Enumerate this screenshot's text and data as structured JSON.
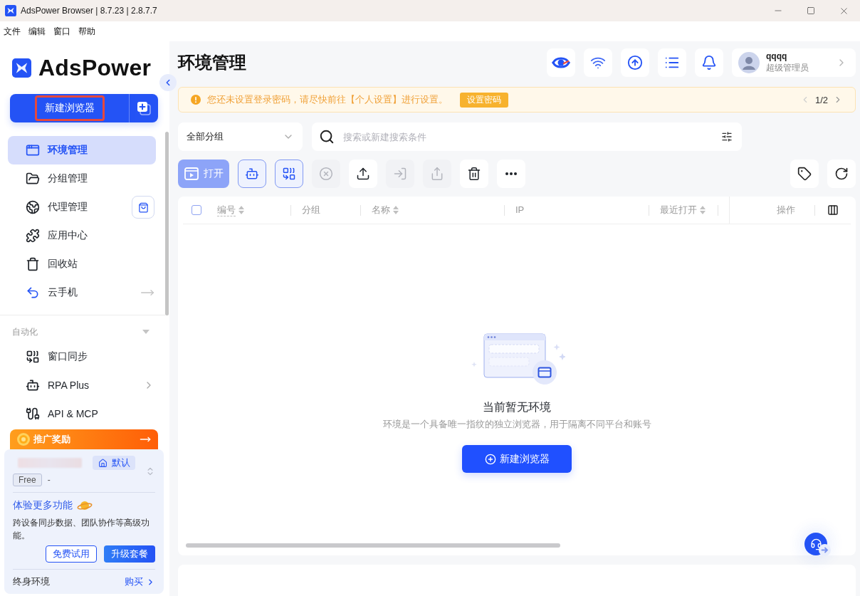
{
  "window": {
    "title": "AdsPower Browser | 8.7.23 | 2.8.7.7"
  },
  "menu_bar": [
    "文件",
    "编辑",
    "窗口",
    "帮助"
  ],
  "sidebar": {
    "logo": "AdsPower",
    "new_browser_button": {
      "label": "新建浏览器",
      "highlighted": true
    },
    "nav_items": [
      {
        "label": "环境管理",
        "selected": true,
        "kind": "plain"
      },
      {
        "label": "分组管理",
        "selected": false,
        "kind": "plain"
      },
      {
        "label": "代理管理",
        "selected": false,
        "kind": "shop"
      },
      {
        "label": "应用中心",
        "selected": false,
        "kind": "plain"
      },
      {
        "label": "回收站",
        "selected": false,
        "kind": "plain"
      },
      {
        "label": "云手机",
        "selected": false,
        "kind": "link"
      }
    ],
    "sections": [
      {
        "title": "自动化",
        "expanded": true,
        "items": [
          {
            "label": "窗口同步",
            "selected": false,
            "kind": "plain"
          },
          {
            "label": "RPA Plus",
            "selected": false,
            "kind": "submenu"
          },
          {
            "label": "API & MCP",
            "selected": false,
            "kind": "plain"
          }
        ]
      }
    ],
    "promo": {
      "banner": "推广奖励",
      "team_tag": "默认",
      "plan": "Free",
      "plan_expiry": "-",
      "upgrade_title": "体验更多功能",
      "upgrade_text": "跨设备同步数据、团队协作等高级功能。",
      "buttons": [
        {
          "label": "免费试用",
          "kind": "outline"
        },
        {
          "label": "升级套餐",
          "kind": "primary"
        }
      ],
      "lifetime_label": "终身环境",
      "lifetime_link": "购买"
    }
  },
  "header": {
    "title": "环境管理",
    "user": {
      "name": "qqqq",
      "role": "超级管理员"
    }
  },
  "notice": {
    "text": "您还未设置登录密码，请尽快前往【个人设置】进行设置。",
    "action": "设置密码",
    "page": "1/2"
  },
  "filters": {
    "group": {
      "value": "全部分组"
    },
    "search": {
      "placeholder": "搜索或新建搜索条件"
    }
  },
  "toolbar": {
    "open_button": {
      "label": "打开",
      "disabled": true
    },
    "tools": [
      {
        "kind": "robot",
        "outlined": true,
        "disabled": false
      },
      {
        "kind": "sync",
        "outlined": true,
        "disabled": false
      },
      {
        "kind": "close",
        "outlined": false,
        "disabled": true
      },
      {
        "kind": "upload",
        "outlined": false,
        "disabled": false
      },
      {
        "kind": "import",
        "outlined": false,
        "disabled": true
      },
      {
        "kind": "share",
        "outlined": false,
        "disabled": true
      },
      {
        "kind": "delete",
        "outlined": false,
        "disabled": false
      },
      {
        "kind": "more",
        "outlined": false,
        "disabled": false
      }
    ]
  },
  "table": {
    "select_all": {
      "checked": false
    },
    "columns": [
      {
        "label": "编号",
        "sortable": true,
        "hint": true
      },
      {
        "label": "分组",
        "sortable": false,
        "hint": false
      },
      {
        "label": "名称",
        "sortable": true,
        "hint": false
      },
      {
        "label": "IP",
        "sortable": false,
        "hint": false
      },
      {
        "label": "最近打开",
        "sortable": true,
        "hint": false
      }
    ],
    "action_column": "操作",
    "empty_state": {
      "title": "当前暂无环境",
      "text": "环境是一个具备唯一指纹的独立浏览器，用于隔离不同平台和账号",
      "button": "新建浏览器"
    }
  }
}
